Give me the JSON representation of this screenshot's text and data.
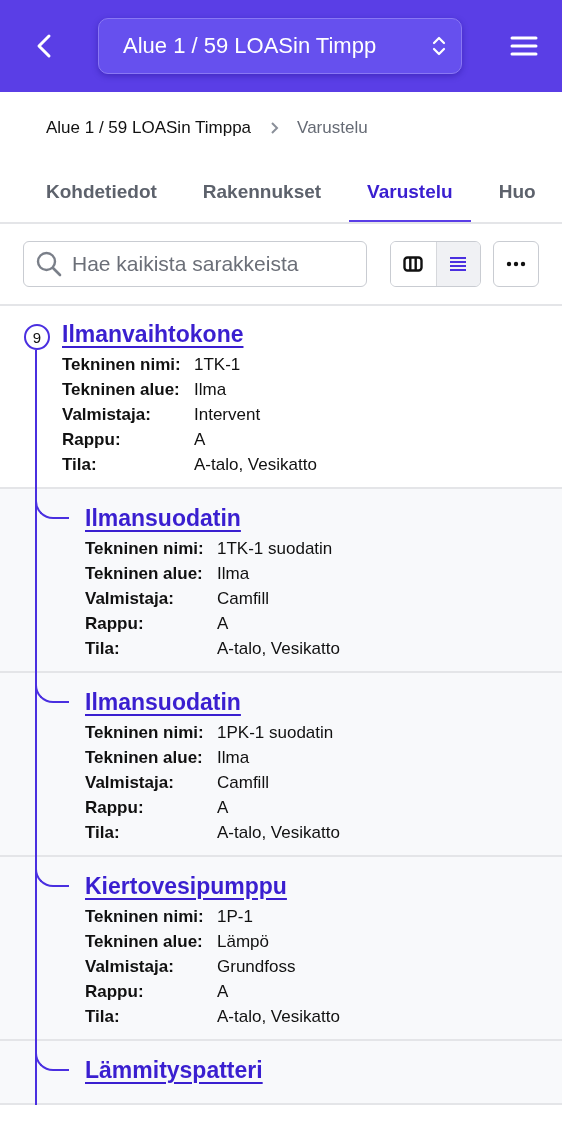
{
  "header": {
    "selector": "Alue 1 / 59 LOASin Timpp"
  },
  "breadcrumb": [
    "Alue 1 / 59 LOASin Timppa",
    "Varustelu"
  ],
  "tabs": [
    {
      "label": "Kohdetiedot",
      "selected": false
    },
    {
      "label": "Rakennukset",
      "selected": false
    },
    {
      "label": "Varustelu",
      "selected": true
    },
    {
      "label": "Huo",
      "selected": false
    }
  ],
  "search": {
    "placeholder": "Hae kaikista sarakkeista"
  },
  "view_toggle": [
    {
      "kind": "columns",
      "selected": false
    },
    {
      "kind": "list",
      "selected": true
    }
  ],
  "tree": {
    "count": "9",
    "title": "Ilmanvaihtokone",
    "fields": [
      {
        "label": "Tekninen nimi:",
        "value": "1TK-1"
      },
      {
        "label": "Tekninen alue:",
        "value": "Ilma"
      },
      {
        "label": "Valmistaja:",
        "value": "Intervent"
      },
      {
        "label": "Rappu:",
        "value": "A"
      },
      {
        "label": "Tila:",
        "value": "A-talo, Vesikatto"
      }
    ],
    "children": [
      {
        "title": "Ilmansuodatin",
        "fields": [
          {
            "label": "Tekninen nimi:",
            "value": "1TK-1 suodatin"
          },
          {
            "label": "Tekninen alue:",
            "value": "Ilma"
          },
          {
            "label": "Valmistaja:",
            "value": "Camfill"
          },
          {
            "label": "Rappu:",
            "value": "A"
          },
          {
            "label": "Tila:",
            "value": "A-talo, Vesikatto"
          }
        ]
      },
      {
        "title": "Ilmansuodatin",
        "fields": [
          {
            "label": "Tekninen nimi:",
            "value": "1PK-1 suodatin"
          },
          {
            "label": "Tekninen alue:",
            "value": "Ilma"
          },
          {
            "label": "Valmistaja:",
            "value": "Camfill"
          },
          {
            "label": "Rappu:",
            "value": "A"
          },
          {
            "label": "Tila:",
            "value": "A-talo, Vesikatto"
          }
        ]
      },
      {
        "title": "Kiertovesipumppu",
        "fields": [
          {
            "label": "Tekninen nimi:",
            "value": "1P-1"
          },
          {
            "label": "Tekninen alue:",
            "value": "Lämpö"
          },
          {
            "label": "Valmistaja:",
            "value": "Grundfoss"
          },
          {
            "label": "Rappu:",
            "value": "A"
          },
          {
            "label": "Tila:",
            "value": "A-talo, Vesikatto"
          }
        ]
      },
      {
        "title": "Lämmityspatteri"
      }
    ]
  }
}
